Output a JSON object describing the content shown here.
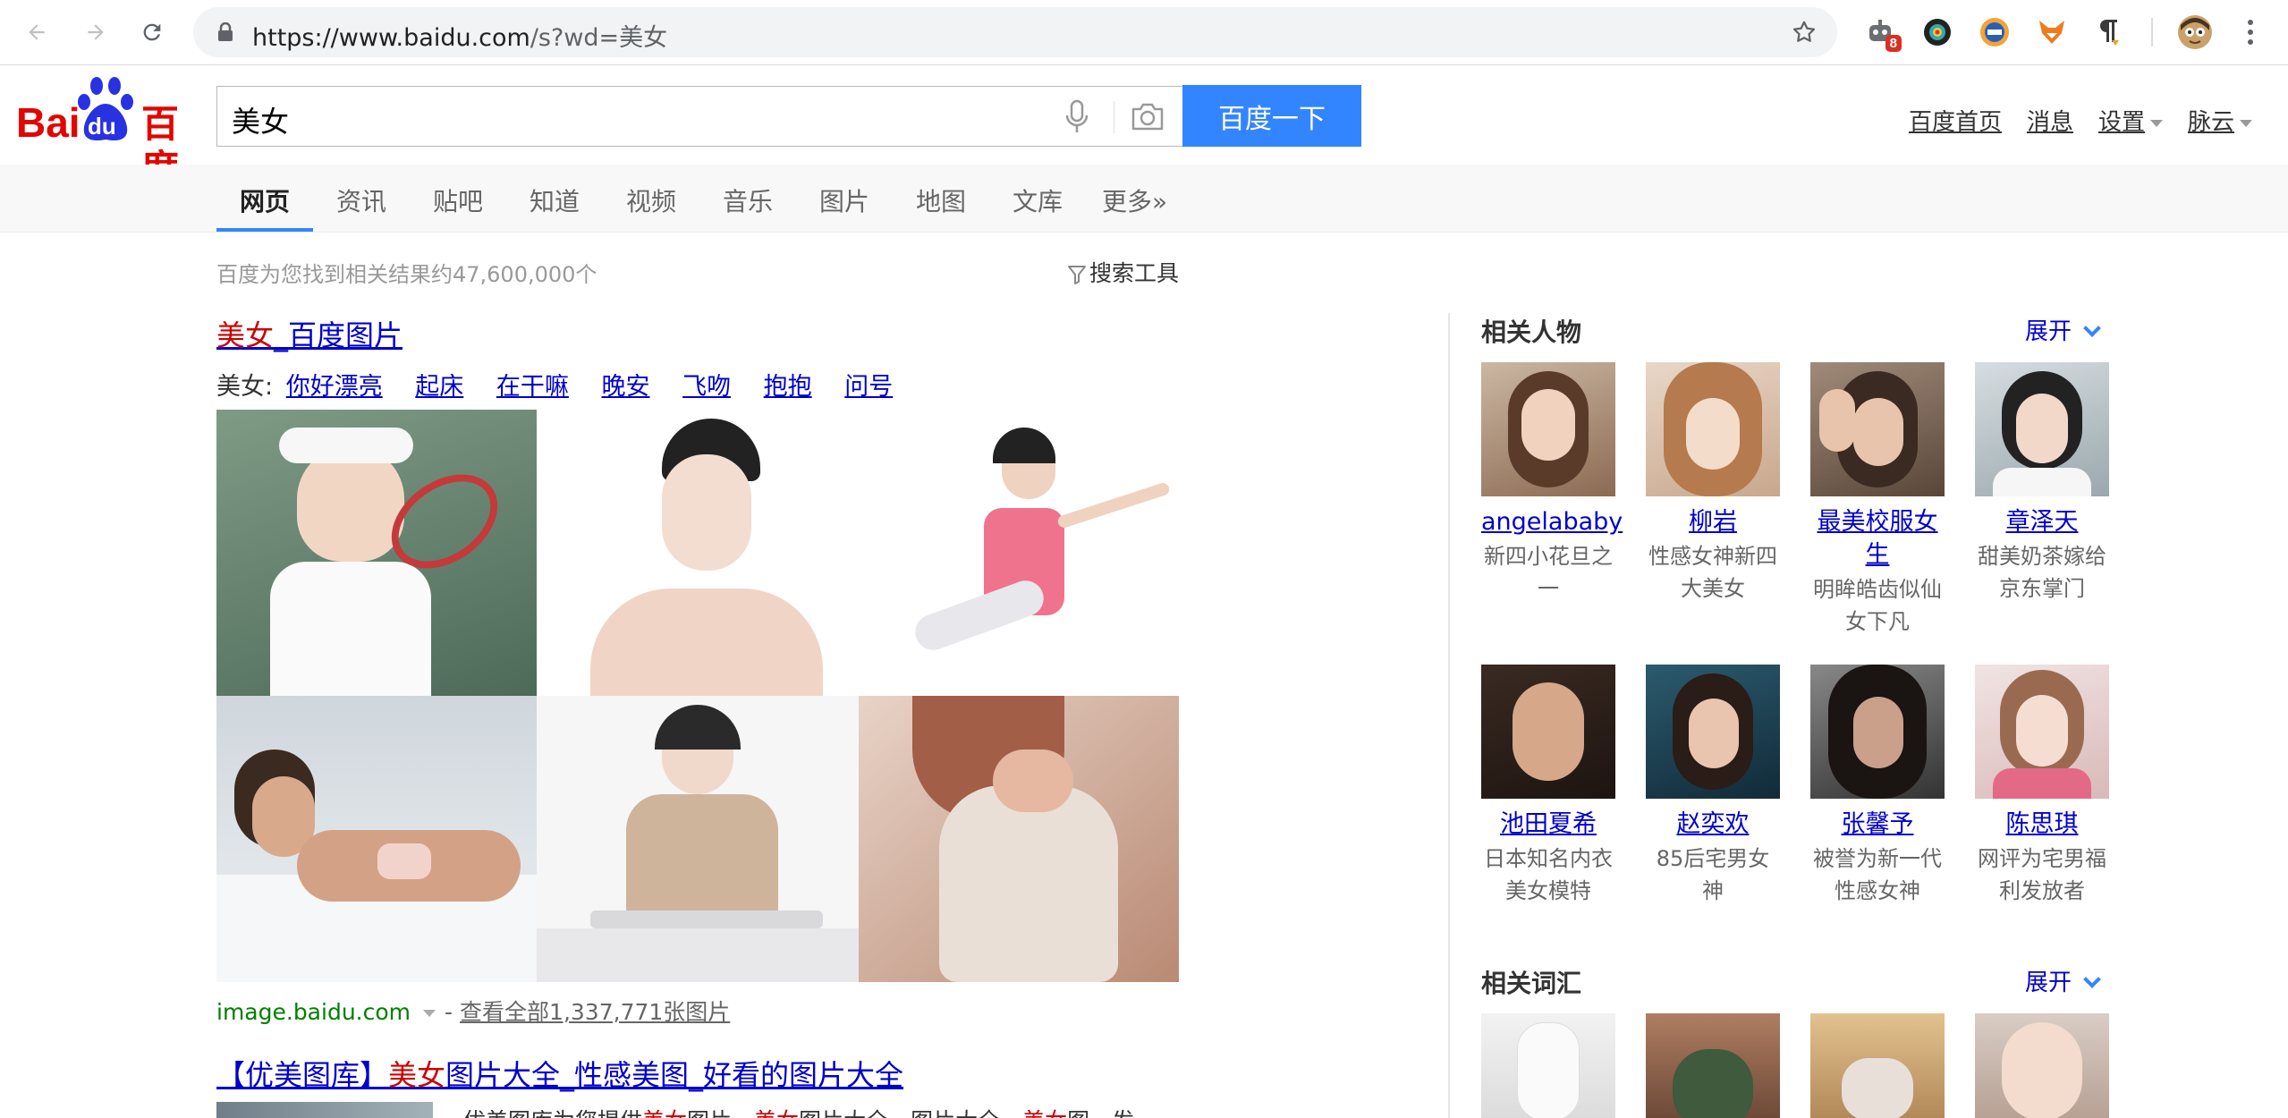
{
  "browser": {
    "url_host": "https://www.baidu.com",
    "url_path": "/s?wd=美女",
    "extension_badge": "8"
  },
  "header": {
    "logo_left": "Bai",
    "logo_paw": "du",
    "logo_right": "百度",
    "query": "美女",
    "search_button": "百度一下",
    "links": [
      "百度首页",
      "消息",
      "设置",
      "脉云"
    ]
  },
  "tabs": [
    "网页",
    "资讯",
    "贴吧",
    "知道",
    "视频",
    "音乐",
    "图片",
    "地图",
    "文库",
    "更多»"
  ],
  "results_count": "百度为您找到相关结果约47,600,000个",
  "search_tools": "搜索工具",
  "result1": {
    "title_em": "美女",
    "title_rest": "_百度图片",
    "sub_label": "美女:",
    "sub_links": [
      "你好漂亮",
      "起床",
      "在干嘛",
      "晚安",
      "飞吻",
      "抱抱",
      "问号"
    ],
    "site": "image.baidu.com",
    "sep": "-",
    "more": "查看全部1,337,771张图片"
  },
  "result2": {
    "title_a": "【优美图库】",
    "title_em": "美女",
    "title_b": "图片大全_性感美图_好看的图片大全",
    "snip_a": "优美图库为您提供",
    "snip_em1": "美女",
    "snip_b": "图片，",
    "snip_em2": "美女",
    "snip_c": "图片大全，图片大全，",
    "snip_em3": "美女",
    "snip_d": "图，发"
  },
  "related_people": {
    "title": "相关人物",
    "expand": "展开",
    "people": [
      {
        "name": "angelababy",
        "desc": "新四小花旦之一"
      },
      {
        "name": "柳岩",
        "desc": "性感女神新四大美女"
      },
      {
        "name": "最美校服女生",
        "desc": "明眸皓齿似仙女下凡"
      },
      {
        "name": "章泽天",
        "desc": "甜美奶茶嫁给京东掌门"
      },
      {
        "name": "池田夏希",
        "desc": "日本知名内衣美女模特"
      },
      {
        "name": "赵奕欢",
        "desc": "85后宅男女神"
      },
      {
        "name": "张馨予",
        "desc": "被誉为新一代性感女神"
      },
      {
        "name": "陈思琪",
        "desc": "网评为宅男福利发放者"
      }
    ]
  },
  "related_words": {
    "title": "相关词汇",
    "expand": "展开"
  },
  "colors": {
    "brand_blue": "#3385ff",
    "logo_red": "#e10601",
    "logo_blue": "#2932e1",
    "link": "#0000cc",
    "highlight": "#cc0000",
    "site_green": "#008000"
  }
}
